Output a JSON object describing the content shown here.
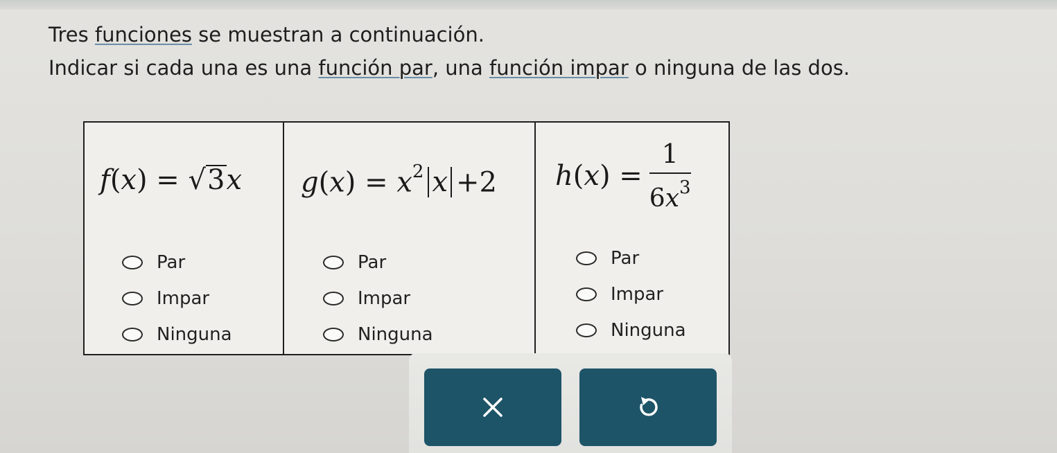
{
  "instructions": {
    "line1": {
      "prefix": "Tres ",
      "link": "funciones",
      "suffix": " se muestran a continuación."
    },
    "line2": {
      "prefix": "Indicar si cada una es una ",
      "link1": "función par",
      "middle": ", una ",
      "link2": "función impar",
      "suffix": " o ninguna de las dos."
    }
  },
  "functions": [
    {
      "id": "f",
      "lhs_name": "f",
      "lhs_var": "x",
      "rhs_radicand": "3",
      "rhs_var": "x",
      "options": [
        "Par",
        "Impar",
        "Ninguna"
      ]
    },
    {
      "id": "g",
      "lhs_name": "g",
      "lhs_var": "x",
      "rhs_base": "x",
      "rhs_exp": "2",
      "rhs_abs": "x",
      "rhs_tail": "+2",
      "options": [
        "Par",
        "Impar",
        "Ninguna"
      ]
    },
    {
      "id": "h",
      "lhs_name": "h",
      "lhs_var": "x",
      "numerator": "1",
      "den_coef": "6",
      "den_var": "x",
      "den_exp": "3",
      "options": [
        "Par",
        "Impar",
        "Ninguna"
      ]
    }
  ],
  "buttons": {
    "clear_icon": "close-icon",
    "undo_icon": "undo-icon",
    "color": "#1e5468"
  }
}
